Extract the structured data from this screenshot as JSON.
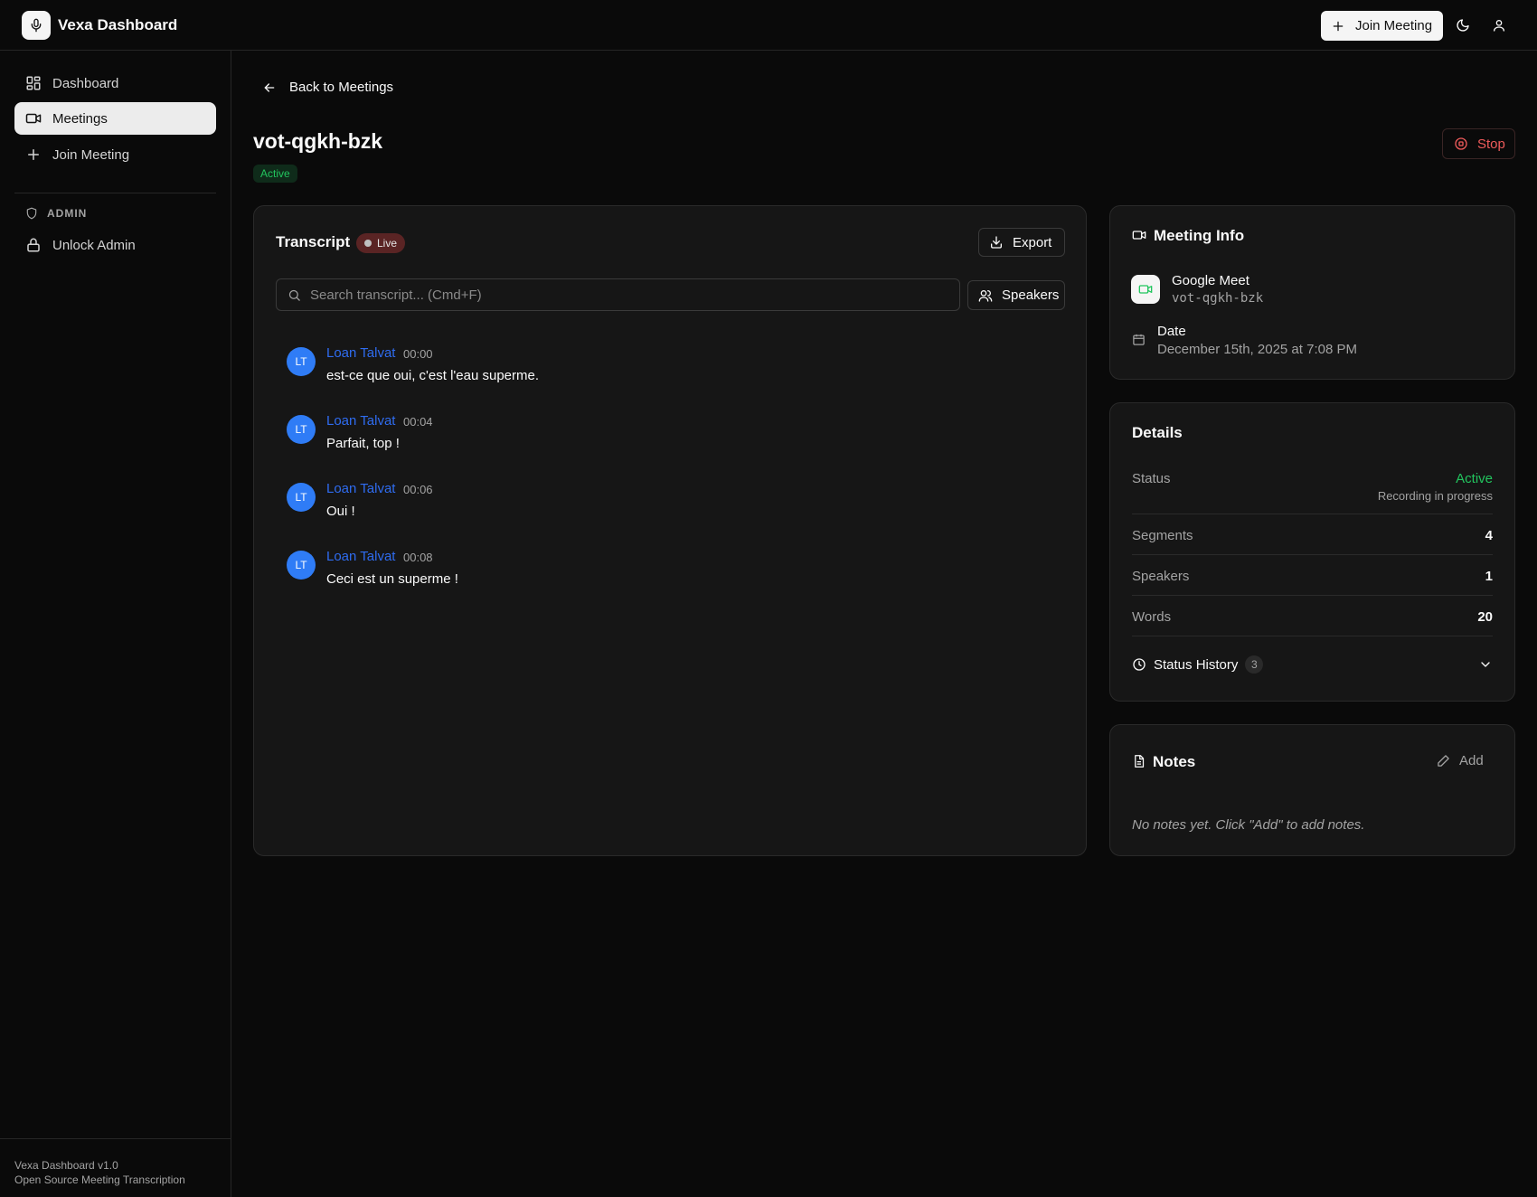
{
  "app": {
    "title": "Vexa Dashboard",
    "join_meeting_label": "Join Meeting"
  },
  "sidebar": {
    "items": [
      {
        "label": "Dashboard",
        "icon": "dashboard-icon"
      },
      {
        "label": "Meetings",
        "icon": "video-icon",
        "active": true
      },
      {
        "label": "Join Meeting",
        "icon": "plus-icon"
      }
    ],
    "admin_section": "ADMIN",
    "unlock_admin": "Unlock Admin",
    "footer_version": "Vexa Dashboard v1.0",
    "footer_tagline": "Open Source Meeting Transcription"
  },
  "page": {
    "back_label": "Back to Meetings",
    "meeting_id": "vot-qgkh-bzk",
    "status": "Active",
    "stop_label": "Stop"
  },
  "transcript": {
    "title": "Transcript",
    "live_label": "Live",
    "export_label": "Export",
    "search_placeholder": "Search transcript... (Cmd+F)",
    "speakers_label": "Speakers",
    "segments": [
      {
        "initials": "LT",
        "speaker": "Loan Talvat",
        "time": "00:00",
        "text": "est-ce que oui, c'est l'eau superme."
      },
      {
        "initials": "LT",
        "speaker": "Loan Talvat",
        "time": "00:04",
        "text": "Parfait, top !"
      },
      {
        "initials": "LT",
        "speaker": "Loan Talvat",
        "time": "00:06",
        "text": "Oui !"
      },
      {
        "initials": "LT",
        "speaker": "Loan Talvat",
        "time": "00:08",
        "text": "Ceci est un superme !"
      }
    ]
  },
  "meeting_info": {
    "title": "Meeting Info",
    "platform": "Google Meet",
    "meeting_code": "vot-qgkh-bzk",
    "date_label": "Date",
    "date_value": "December 15th, 2025 at 7:08 PM"
  },
  "details": {
    "title": "Details",
    "status_label": "Status",
    "status_value": "Active",
    "status_sub": "Recording in progress",
    "segments_label": "Segments",
    "segments_value": "4",
    "speakers_label": "Speakers",
    "speakers_value": "1",
    "words_label": "Words",
    "words_value": "20",
    "history_label": "Status History",
    "history_count": "3"
  },
  "notes": {
    "title": "Notes",
    "add_label": "Add",
    "empty_text": "No notes yet. Click \"Add\" to add notes."
  },
  "colors": {
    "accent_green": "#22c55e",
    "stop_red": "#ef5b5b",
    "speaker_blue": "#2f6cf0",
    "avatar_blue": "#2f7cf6"
  }
}
